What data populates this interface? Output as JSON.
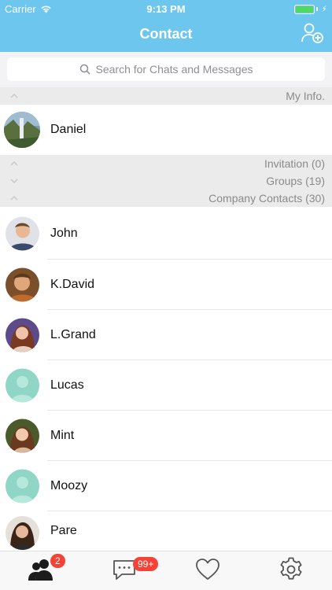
{
  "status": {
    "carrier": "Carrier",
    "time": "9:13 PM"
  },
  "nav": {
    "title": "Contact",
    "add_icon": "add-contact-icon"
  },
  "search": {
    "placeholder": "Search for Chats and Messages"
  },
  "sections": {
    "my_info": "My Info.",
    "invitation": "Invitation (0)",
    "groups": "Groups (19)",
    "company": "Company Contacts (30)"
  },
  "me": {
    "name": "Daniel"
  },
  "contacts": [
    {
      "name": "John"
    },
    {
      "name": "K.David"
    },
    {
      "name": "L.Grand"
    },
    {
      "name": "Lucas"
    },
    {
      "name": "Mint"
    },
    {
      "name": "Moozy"
    },
    {
      "name": "Pare"
    }
  ],
  "tabbar": {
    "contacts_badge": "2",
    "messages_badge": "99+"
  },
  "colors": {
    "header": "#6cc6ee",
    "badge": "#f44336",
    "placeholder_avatar": "#8fd6c6"
  }
}
